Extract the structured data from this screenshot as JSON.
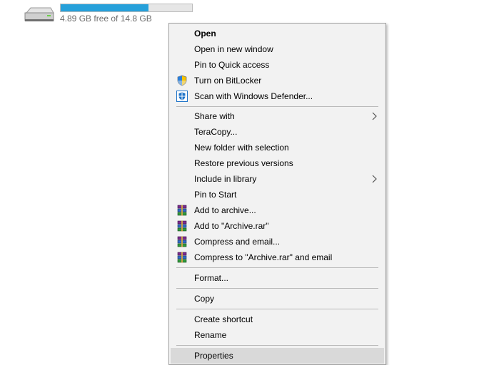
{
  "drive": {
    "icon": "hard-drive-icon",
    "name_partial": "(:)",
    "free_text": "4.89 GB free of 14.8 GB",
    "used_fraction": 0.67,
    "bar_color": "#26a0da"
  },
  "menu": {
    "items": [
      {
        "label": "Open"
      },
      {
        "label": "Open in new window"
      },
      {
        "label": "Pin to Quick access"
      },
      {
        "label": "Turn on BitLocker",
        "icon": "bitlocker-shield-icon"
      },
      {
        "label": "Scan with Windows Defender...",
        "icon": "windows-defender-icon"
      },
      {
        "label": "Share with",
        "icon": "submenu-chevron-icon"
      },
      {
        "label": "TeraCopy..."
      },
      {
        "label": "New folder with selection"
      },
      {
        "label": "Restore previous versions"
      },
      {
        "label": "Include in library",
        "icon": "submenu-chevron-icon"
      },
      {
        "label": "Pin to Start"
      },
      {
        "label": "Add to archive...",
        "icon": "winrar-icon"
      },
      {
        "label": "Add to \"Archive.rar\"",
        "icon": "winrar-icon"
      },
      {
        "label": "Compress and email...",
        "icon": "winrar-icon"
      },
      {
        "label": "Compress to \"Archive.rar\" and email",
        "icon": "winrar-icon"
      },
      {
        "label": "Format..."
      },
      {
        "label": "Copy"
      },
      {
        "label": "Create shortcut"
      },
      {
        "label": "Rename"
      },
      {
        "label": "Properties",
        "highlighted": true
      }
    ]
  },
  "colors": {
    "menu_bg": "#f2f2f2",
    "highlight": "#d9d9d9",
    "separator": "#b9b9b9"
  }
}
